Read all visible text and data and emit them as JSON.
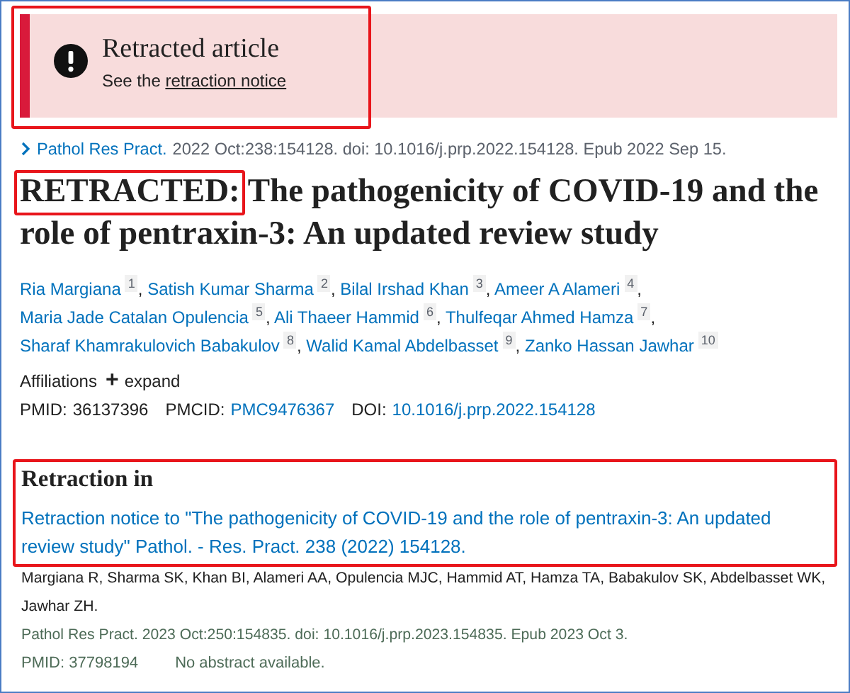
{
  "banner": {
    "title": "Retracted article",
    "text": "See the ",
    "link": "retraction notice",
    "highlighted": true
  },
  "citation": {
    "journal": "Pathol Res Pract.",
    "details": "2022 Oct:238:154128. doi: 10.1016/j.prp.2022.154128. Epub 2022 Sep 15."
  },
  "title": {
    "prefix": "RETRACTED:",
    "prefix_highlighted": true,
    "text": "The pathogenicity of COVID-19 and the role of pentraxin-3: An updated review study"
  },
  "authors": [
    {
      "name": "Ria Margiana",
      "ref": "1",
      "trailing": ","
    },
    {
      "name": "Satish Kumar Sharma",
      "ref": "2",
      "trailing": ","
    },
    {
      "name": "Bilal Irshad Khan",
      "ref": "3",
      "trailing": ","
    },
    {
      "name": "Ameer A Alameri",
      "ref": "4",
      "trailing": ","
    },
    {
      "name": "Maria Jade Catalan Opulencia",
      "ref": "5",
      "trailing": ","
    },
    {
      "name": "Ali Thaeer Hammid",
      "ref": "6",
      "trailing": ","
    },
    {
      "name": "Thulfeqar Ahmed Hamza",
      "ref": "7",
      "trailing": ","
    },
    {
      "name": "Sharaf Khamrakulovich Babakulov",
      "ref": "8",
      "trailing": ","
    },
    {
      "name": "Walid Kamal Abdelbasset",
      "ref": "9",
      "trailing": ","
    },
    {
      "name": "Zanko Hassan Jawhar",
      "ref": "10"
    }
  ],
  "affiliations": {
    "label": "Affiliations",
    "toggle": "+",
    "action": "expand"
  },
  "ids": [
    {
      "label": "PMID:",
      "value": "36137396",
      "link": false
    },
    {
      "label": "PMCID:",
      "value": "PMC9476367",
      "link": true
    },
    {
      "label": "DOI:",
      "value": "10.1016/j.prp.2022.154128",
      "link": true
    }
  ],
  "retraction": {
    "heading": "Retraction in",
    "highlighted": true,
    "link": "Retraction notice to \"The pathogenicity of COVID-19 and the role of pentraxin-3: An updated review study\" Pathol. - Res. Pract. 238 (2022) 154128.",
    "authors": "Margiana R, Sharma SK, Khan BI, Alameri AA, Opulencia MJC, Hammid AT, Hamza TA, Babakulov SK, Abdelbasset WK, Jawhar ZH.",
    "citation": "Pathol Res Pract. 2023 Oct:250:154835. doi: 10.1016/j.prp.2023.154835. Epub 2023 Oct 3.",
    "pmid": "PMID: 37798194",
    "note": "No abstract available."
  }
}
